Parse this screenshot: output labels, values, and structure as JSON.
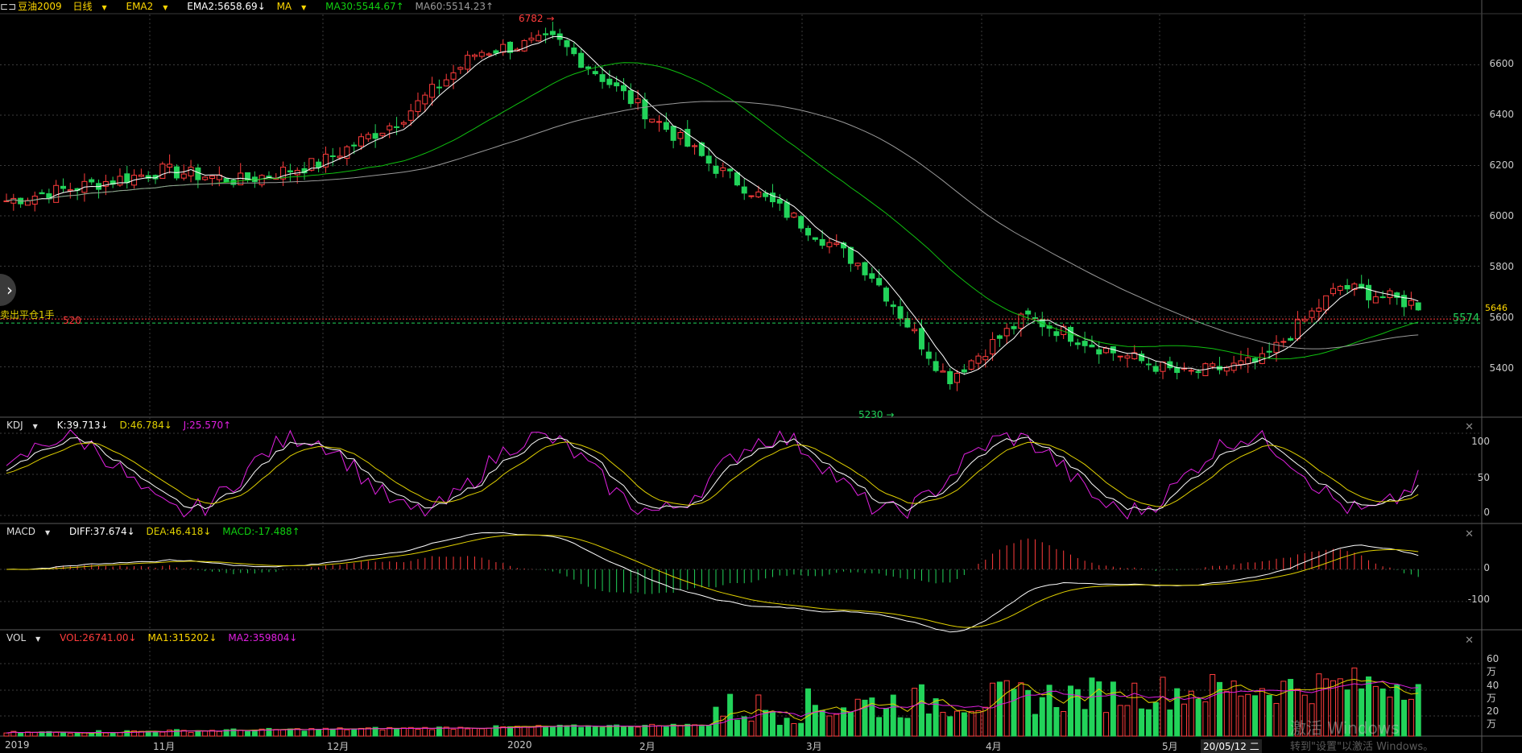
{
  "header": {
    "symbol": "豆油2009",
    "period": "日线",
    "ema_name": "EMA2",
    "ema_value": "EMA2:5658.69↓",
    "ma_name": "MA",
    "ma30": "MA30:5544.67↑",
    "ma60": "MA60:5514.23↑"
  },
  "kdj_header": {
    "name": "KDJ",
    "k": "K:39.713↓",
    "d": "D:46.784↓",
    "j": "J:25.570↑"
  },
  "macd_header": {
    "name": "MACD",
    "diff": "DIFF:37.674↓",
    "dea": "DEA:46.418↓",
    "macd": "MACD:-17.488↑"
  },
  "vol_header": {
    "name": "VOL",
    "vol": "VOL:26741.00↓",
    "ma1": "MA1:315202↓",
    "ma2": "MA2:359804↓"
  },
  "annotations": {
    "high": "6782",
    "low": "5230",
    "order": "卖出平仓1手",
    "order_price": "520",
    "last_price": "5646",
    "line_price": "5574",
    "cursor_date": "20/05/12 二"
  },
  "price_axis": [
    "6600",
    "6400",
    "6200",
    "6000",
    "5800",
    "5600",
    "5400"
  ],
  "kdj_axis": [
    "100",
    "50",
    "0"
  ],
  "macd_axis": [
    "0",
    "-100"
  ],
  "vol_axis": [
    "60万",
    "40万",
    "20万"
  ],
  "time_axis": [
    "2019",
    "11月",
    "12月",
    "2020",
    "2月",
    "3月",
    "4月",
    "5月"
  ],
  "watermark": {
    "line1": "激活 Windows",
    "line2": "转到\"设置\"以激活 Windows。"
  },
  "colors": {
    "up": "#ff3c3c",
    "down": "#22d35a",
    "ema": "#ffffff",
    "ma30": "#10c010",
    "ma60": "#9a9a9a",
    "k": "#ffffff",
    "d": "#e0d000",
    "j": "#e020e0"
  },
  "chart_data": {
    "type": "candlestick",
    "price_range": [
      5200,
      6800
    ],
    "high_point": 6782,
    "low_point": 5230,
    "ohlc_sample": {
      "note_dates": [
        "2019-10",
        "2019-11",
        "2019-12",
        "2020-01",
        "2020-02",
        "2020-03",
        "2020-04",
        "2020-05"
      ],
      "closes": [
        6060,
        6120,
        6180,
        6140,
        6210,
        6380,
        6650,
        6700,
        6450,
        6200,
        6000,
        5780,
        5350,
        5600,
        5470,
        5370,
        5420,
        5720,
        5646
      ]
    },
    "ma_current": {
      "EMA2": 5658.69,
      "MA30": 5544.67,
      "MA60": 5514.23
    },
    "kdj": {
      "K": 39.713,
      "D": 46.784,
      "J": 25.57
    },
    "macd": {
      "DIFF": 37.674,
      "DEA": 46.418,
      "MACD": -17.488
    },
    "vol": {
      "VOL": 26741.0,
      "MA1": 315202,
      "MA2": 359804
    }
  }
}
